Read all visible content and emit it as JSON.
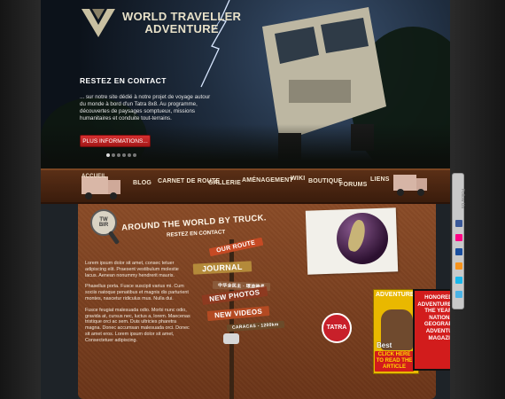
{
  "brand": {
    "logo_line1": "WORLD TRAVELLER",
    "logo_line2": "ADVENTURE"
  },
  "hero": {
    "title": "RESTEZ EN CONTACT",
    "text": "... sur notre site dédié à notre projet de voyage autour du monde à bord d'un Tatra 8x8. Au programme, découvertes de paysages somptueux, missions humanitaires et conduite tout-terrains.",
    "button_label": "PLUS INFORMATIONS...",
    "slide_dots": 6,
    "active_dot": 0
  },
  "nav": {
    "items": [
      {
        "label": "ACCUEIL"
      },
      {
        "label": "BLOG"
      },
      {
        "label": "CARNET DE ROUTE"
      },
      {
        "label": "GALLERIE"
      },
      {
        "label": "AMÉNAGEMENT"
      },
      {
        "label": "WIKI"
      },
      {
        "label": "BOUTIQUE"
      },
      {
        "label": "FORUMS"
      },
      {
        "label": "LIENS"
      }
    ]
  },
  "content": {
    "badge": "TW\nBIR",
    "title": "AROUND THE WORLD BY TRUCK.",
    "subtitle": "RESTEZ EN CONTACT",
    "paragraphs": [
      "Lorem ipsum dolor sit amet, consec tetuer adipiscing elit. Praesent vestibulum molestie lacus. Aenean nonummy hendrerit mauris.",
      "Phasellus porta. Fusce suscipit varius mi. Cum sociis natoque penatibus et magnis dis parturient montes, nascetur ridiculus mus. Nulla dui.",
      "Fusce feugiat malesuada odio. Morbi nunc odio, gravida at, cursus nec, luctus a, lorem. Maecenas tristique orci ac sem. Duis ultricies pharetra magna. Donec accumsan malesuada orci. Donec sit amet eros. Lorem ipsum dolor sit amet, Consectetuer adipiscing."
    ],
    "signs": [
      {
        "label": "OUR ROUTE",
        "color": "#c64a24"
      },
      {
        "label": "JOURNAL",
        "color": "#b48a3a"
      },
      {
        "label": "中华全民主 · 環途時長",
        "color": "#8a5a3a"
      },
      {
        "label": "NEW PHOTOS",
        "color": "#8e3a20"
      },
      {
        "label": "NEW VIDEOS",
        "color": "#b44a22"
      },
      {
        "label": "CARACAS - 1200km",
        "color": "#6b4b2a"
      }
    ],
    "tatra_logo": "TATRA",
    "magazine": {
      "title": "ADVENTURE",
      "best": "Best",
      "click_text": "CLICK HERE TO READ THE ARTICLE"
    },
    "award_text": "HONORED AS ADVENTURERS OF THE YEAR BY NATIONAL GEOGRAPHIC ADVENTURE MAGAZINE"
  },
  "social_bar": {
    "label": "Follow Us",
    "icons": [
      {
        "name": "facebook-icon",
        "color": "#3b5998"
      },
      {
        "name": "flickr-icon",
        "color": "#ff0084"
      },
      {
        "name": "myspace-icon",
        "color": "#1b4f9e"
      },
      {
        "name": "rss-icon",
        "color": "#f7941e"
      },
      {
        "name": "vimeo-icon",
        "color": "#1ab7ea"
      },
      {
        "name": "twitter-icon",
        "color": "#4ab3e6"
      }
    ]
  }
}
